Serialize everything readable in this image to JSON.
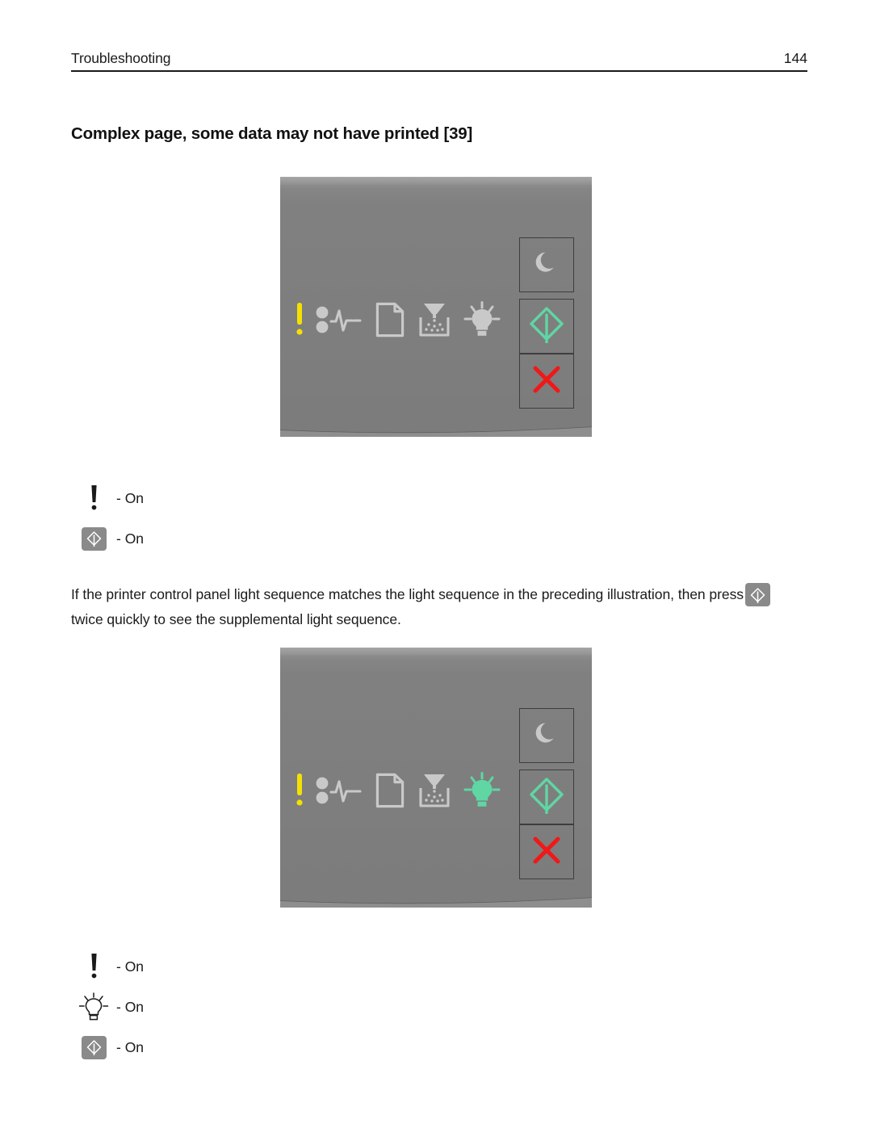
{
  "header": {
    "section": "Troubleshooting",
    "page_number": "144"
  },
  "title": "Complex page, some data may not have printed [39]",
  "panels": [
    {
      "name": "primary-light-sequence",
      "lights": [
        {
          "icon": "error-exclamation-icon",
          "state": "on",
          "color": "#f5e100"
        },
        {
          "icon": "paper-jam-icon",
          "state": "off",
          "color": "#c9c9c9"
        },
        {
          "icon": "load-paper-icon",
          "state": "off",
          "color": "#c9c9c9"
        },
        {
          "icon": "toner-icon",
          "state": "off",
          "color": "#c9c9c9"
        },
        {
          "icon": "light-bulb-icon",
          "state": "off",
          "color": "#c9c9c9"
        }
      ],
      "buttons": [
        {
          "icon": "sleep-moon-icon",
          "color": "#c9c9c9"
        },
        {
          "icon": "start-diamond-icon",
          "color": "#5fd6a4"
        },
        {
          "icon": "cancel-x-icon",
          "color": "#f01818"
        }
      ]
    },
    {
      "name": "supplemental-light-sequence",
      "lights": [
        {
          "icon": "error-exclamation-icon",
          "state": "on",
          "color": "#f5e100"
        },
        {
          "icon": "paper-jam-icon",
          "state": "off",
          "color": "#c9c9c9"
        },
        {
          "icon": "load-paper-icon",
          "state": "off",
          "color": "#c9c9c9"
        },
        {
          "icon": "toner-icon",
          "state": "off",
          "color": "#c9c9c9"
        },
        {
          "icon": "light-bulb-icon",
          "state": "on",
          "color": "#5fd6a4"
        }
      ],
      "buttons": [
        {
          "icon": "sleep-moon-icon",
          "color": "#c9c9c9"
        },
        {
          "icon": "start-diamond-icon",
          "color": "#5fd6a4"
        },
        {
          "icon": "cancel-x-icon",
          "color": "#f01818"
        }
      ]
    }
  ],
  "legend_primary": {
    "rows": [
      {
        "icon": "error-exclamation-icon",
        "state": "- On"
      },
      {
        "icon": "start-button-icon",
        "state": "- On"
      }
    ]
  },
  "legend_supplemental": {
    "rows": [
      {
        "icon": "error-exclamation-icon",
        "state": "- On"
      },
      {
        "icon": "light-bulb-icon",
        "state": "- On"
      },
      {
        "icon": "start-button-icon",
        "state": "- On"
      }
    ]
  },
  "body": {
    "text_before": "If the printer control panel light sequence matches the light sequence in the preceding illustration, then press",
    "inline_icon": "start-button-icon",
    "text_after": "twice quickly to see the supplemental light sequence."
  },
  "colors": {
    "panel_gray": "#7e7e7e",
    "led_off": "#c9c9c9",
    "led_amber": "#f5e100",
    "led_green": "#5fd6a4",
    "cancel_red": "#f01818",
    "chip_gray": "#8a8a8a"
  }
}
